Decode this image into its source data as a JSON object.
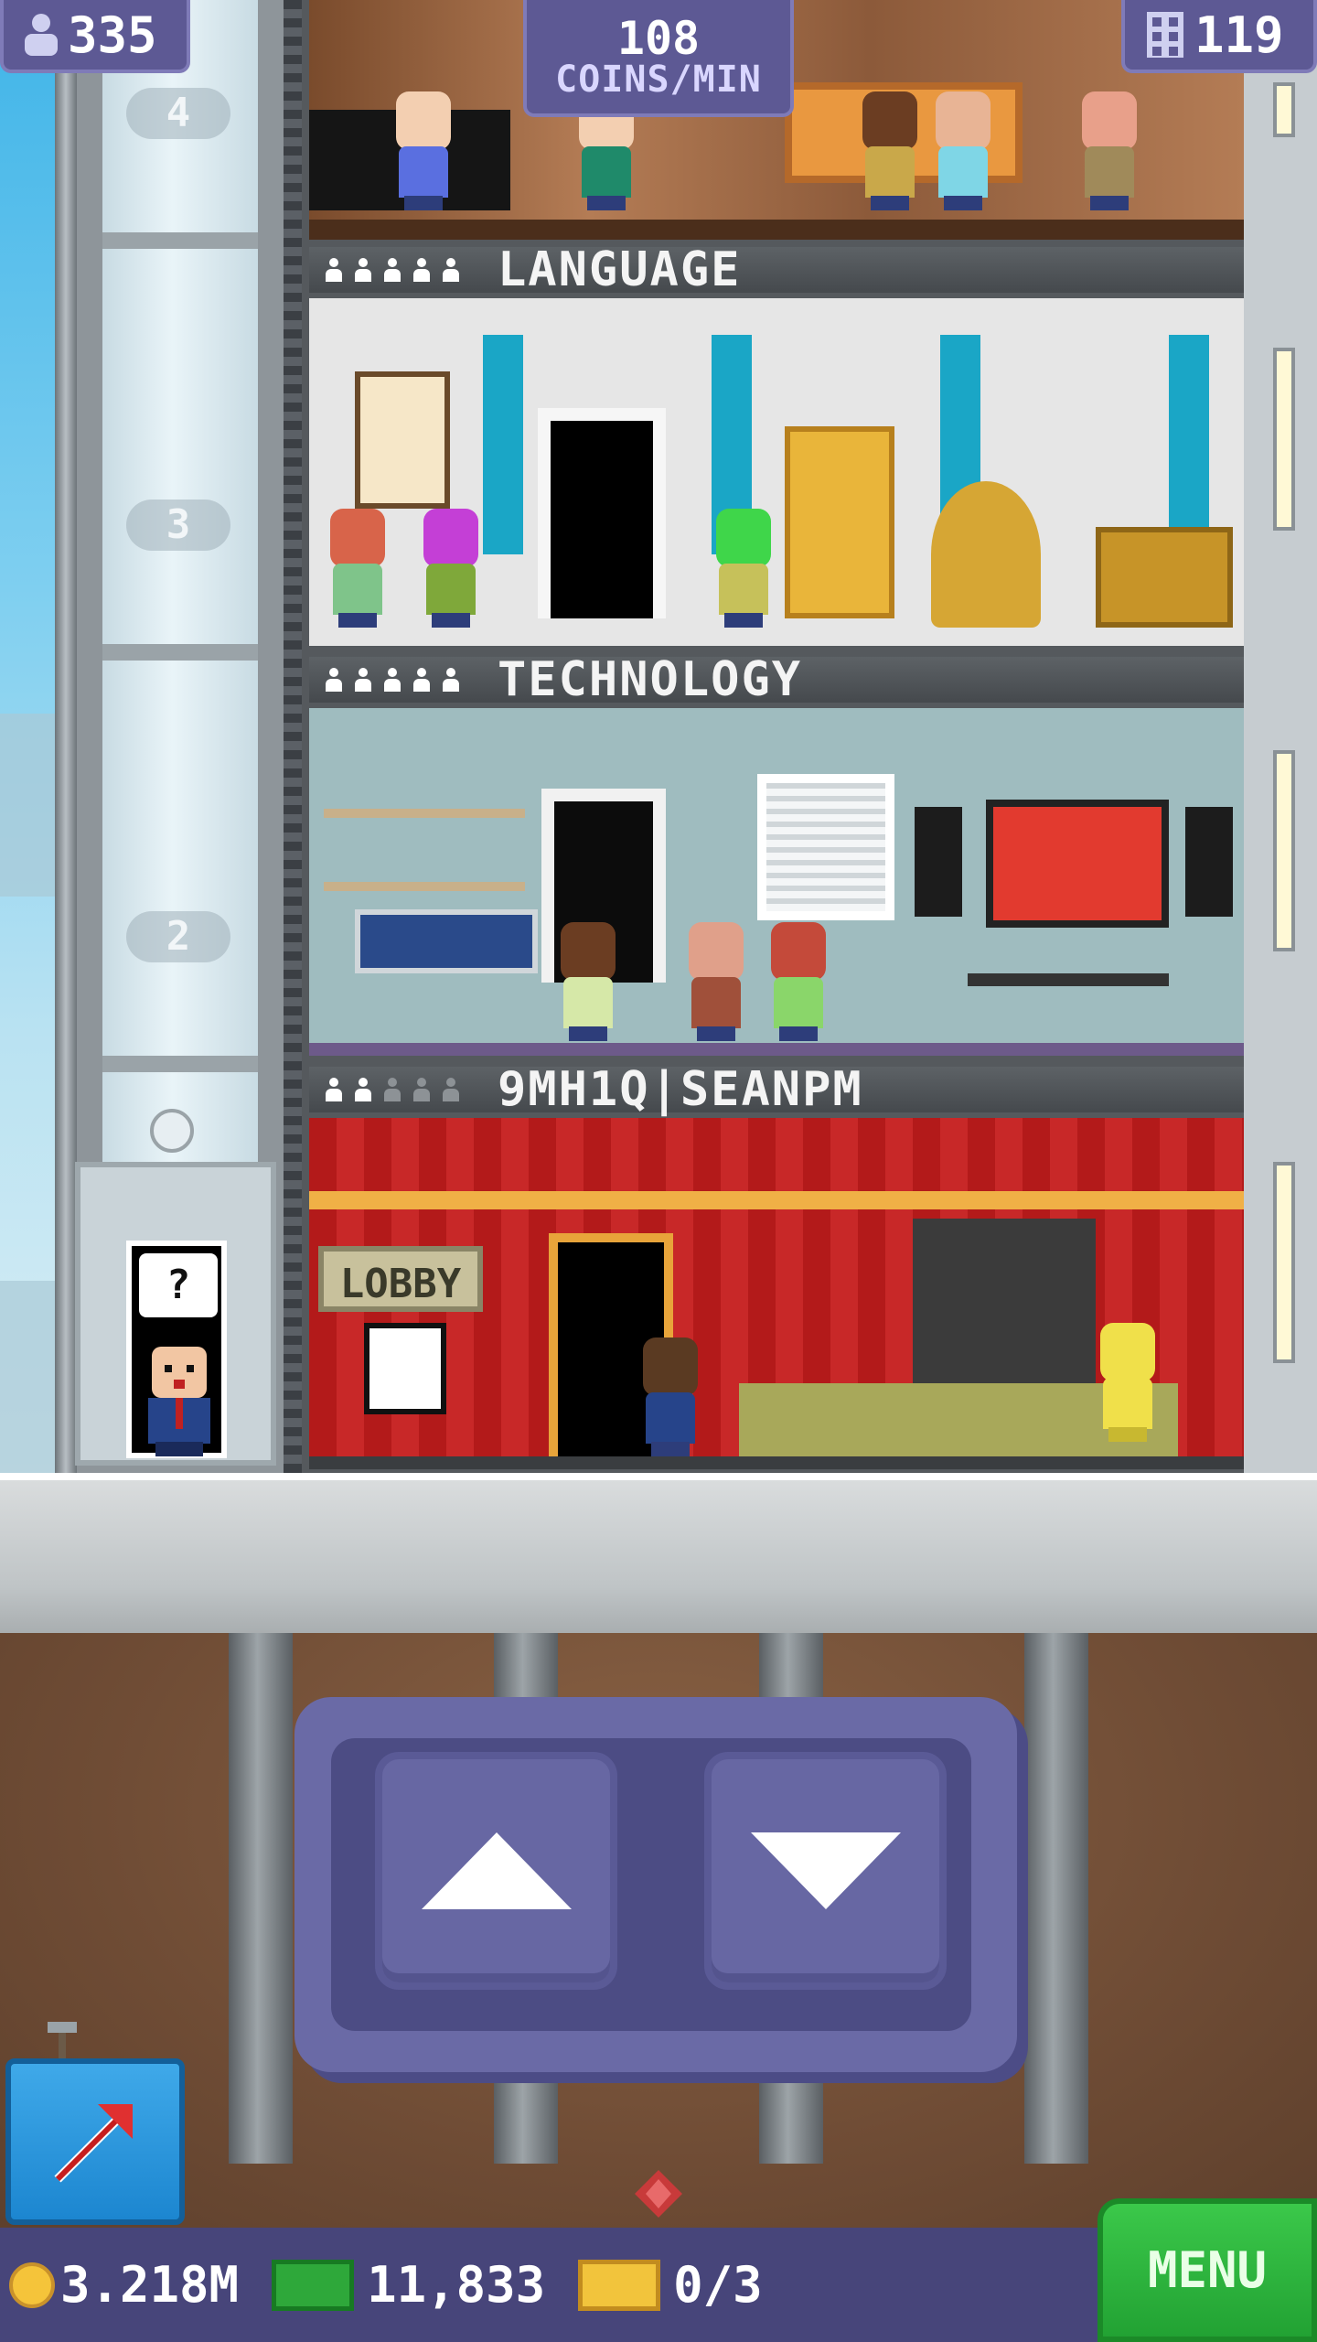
{
  "hud": {
    "population": "335",
    "floors": "119",
    "coins_per_min_value": "108",
    "coins_per_min_label": "COINS/MIN"
  },
  "elevator": {
    "floor_numbers": [
      "4",
      "3",
      "2"
    ],
    "operator_speech": "?"
  },
  "floors": [
    {
      "name": "LANGUAGE",
      "rating_filled": 5,
      "rating_total": 5
    },
    {
      "name": "TECHNOLOGY",
      "rating_filled": 5,
      "rating_total": 5
    },
    {
      "name": "9MH1Q|SEANPM",
      "rating_filled": 2,
      "rating_total": 5,
      "sign": "LOBBY"
    }
  ],
  "bottom_bar": {
    "coins": "3.218M",
    "cash": "11,833",
    "bux": "0/3",
    "menu_label": "MENU"
  },
  "colors": {
    "hud_purple": "#5d5994",
    "menu_green": "#2db83f",
    "build_blue": "#2a95dc",
    "lobby_red": "#c02121",
    "language_teal": "#1aa6c6"
  },
  "icons": {
    "population": "person-icon",
    "floors": "building-icon",
    "coins": "coin-icon",
    "cash": "cash-icon",
    "bux": "ticket-icon",
    "build": "hammer-arrow-icon",
    "elevator_up": "triangle-up-icon",
    "elevator_down": "triangle-down-icon"
  }
}
